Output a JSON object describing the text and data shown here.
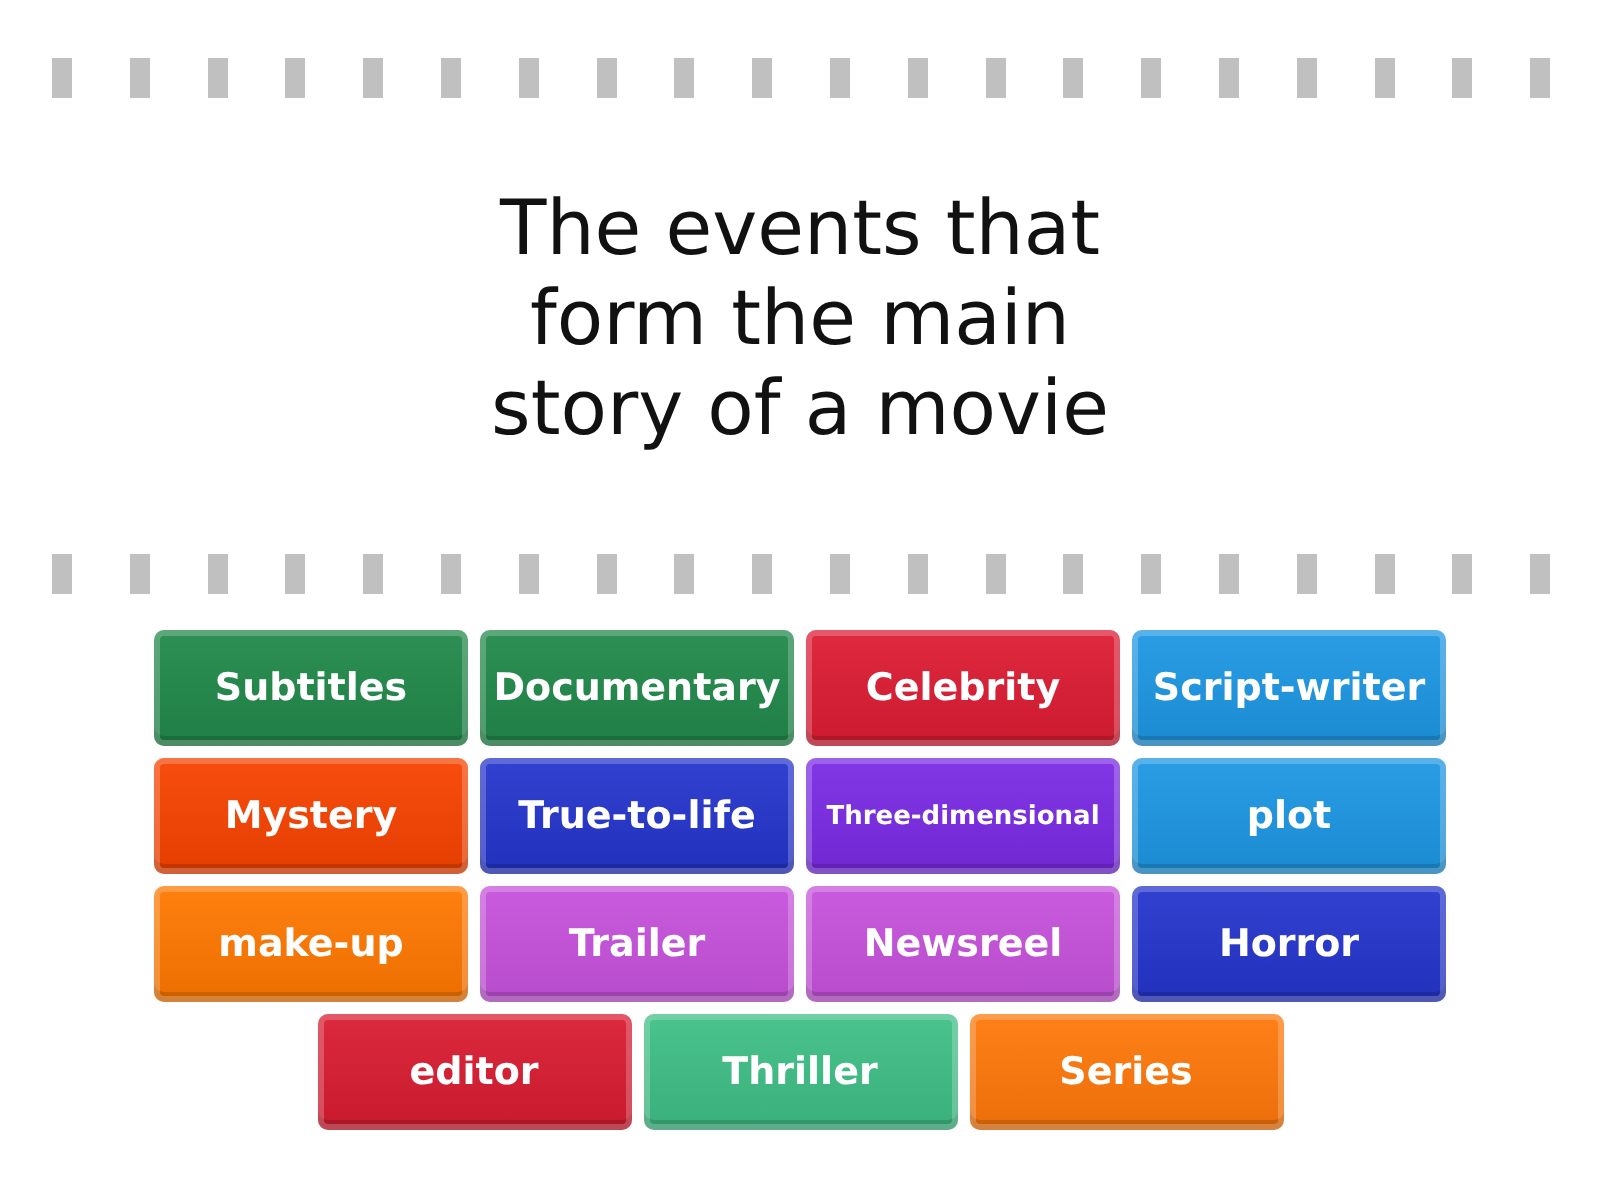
{
  "prompt": {
    "text": "The events that form the main story of a movie"
  },
  "tiles": [
    {
      "label": "Subtitles",
      "color": "#21894b"
    },
    {
      "label": "Documentary",
      "color": "#21894b"
    },
    {
      "label": "Celebrity",
      "color": "#dd1c33"
    },
    {
      "label": "Script-writer",
      "color": "#1d97e3"
    },
    {
      "label": "Mystery",
      "color": "#f74300"
    },
    {
      "label": "True-to-life",
      "color": "#2535cc"
    },
    {
      "label": "Three-dimensional",
      "color": "#7a2be4"
    },
    {
      "label": "plot",
      "color": "#1d97e3"
    },
    {
      "label": "make-up",
      "color": "#ff7800"
    },
    {
      "label": "Trailer",
      "color": "#c652dc"
    },
    {
      "label": "Newsreel",
      "color": "#c652dc"
    },
    {
      "label": "Horror",
      "color": "#2535cc"
    },
    {
      "label": "editor",
      "color": "#d91c31"
    },
    {
      "label": "Thriller",
      "color": "#3fbf86"
    },
    {
      "label": "Series",
      "color": "#ff780a"
    }
  ]
}
